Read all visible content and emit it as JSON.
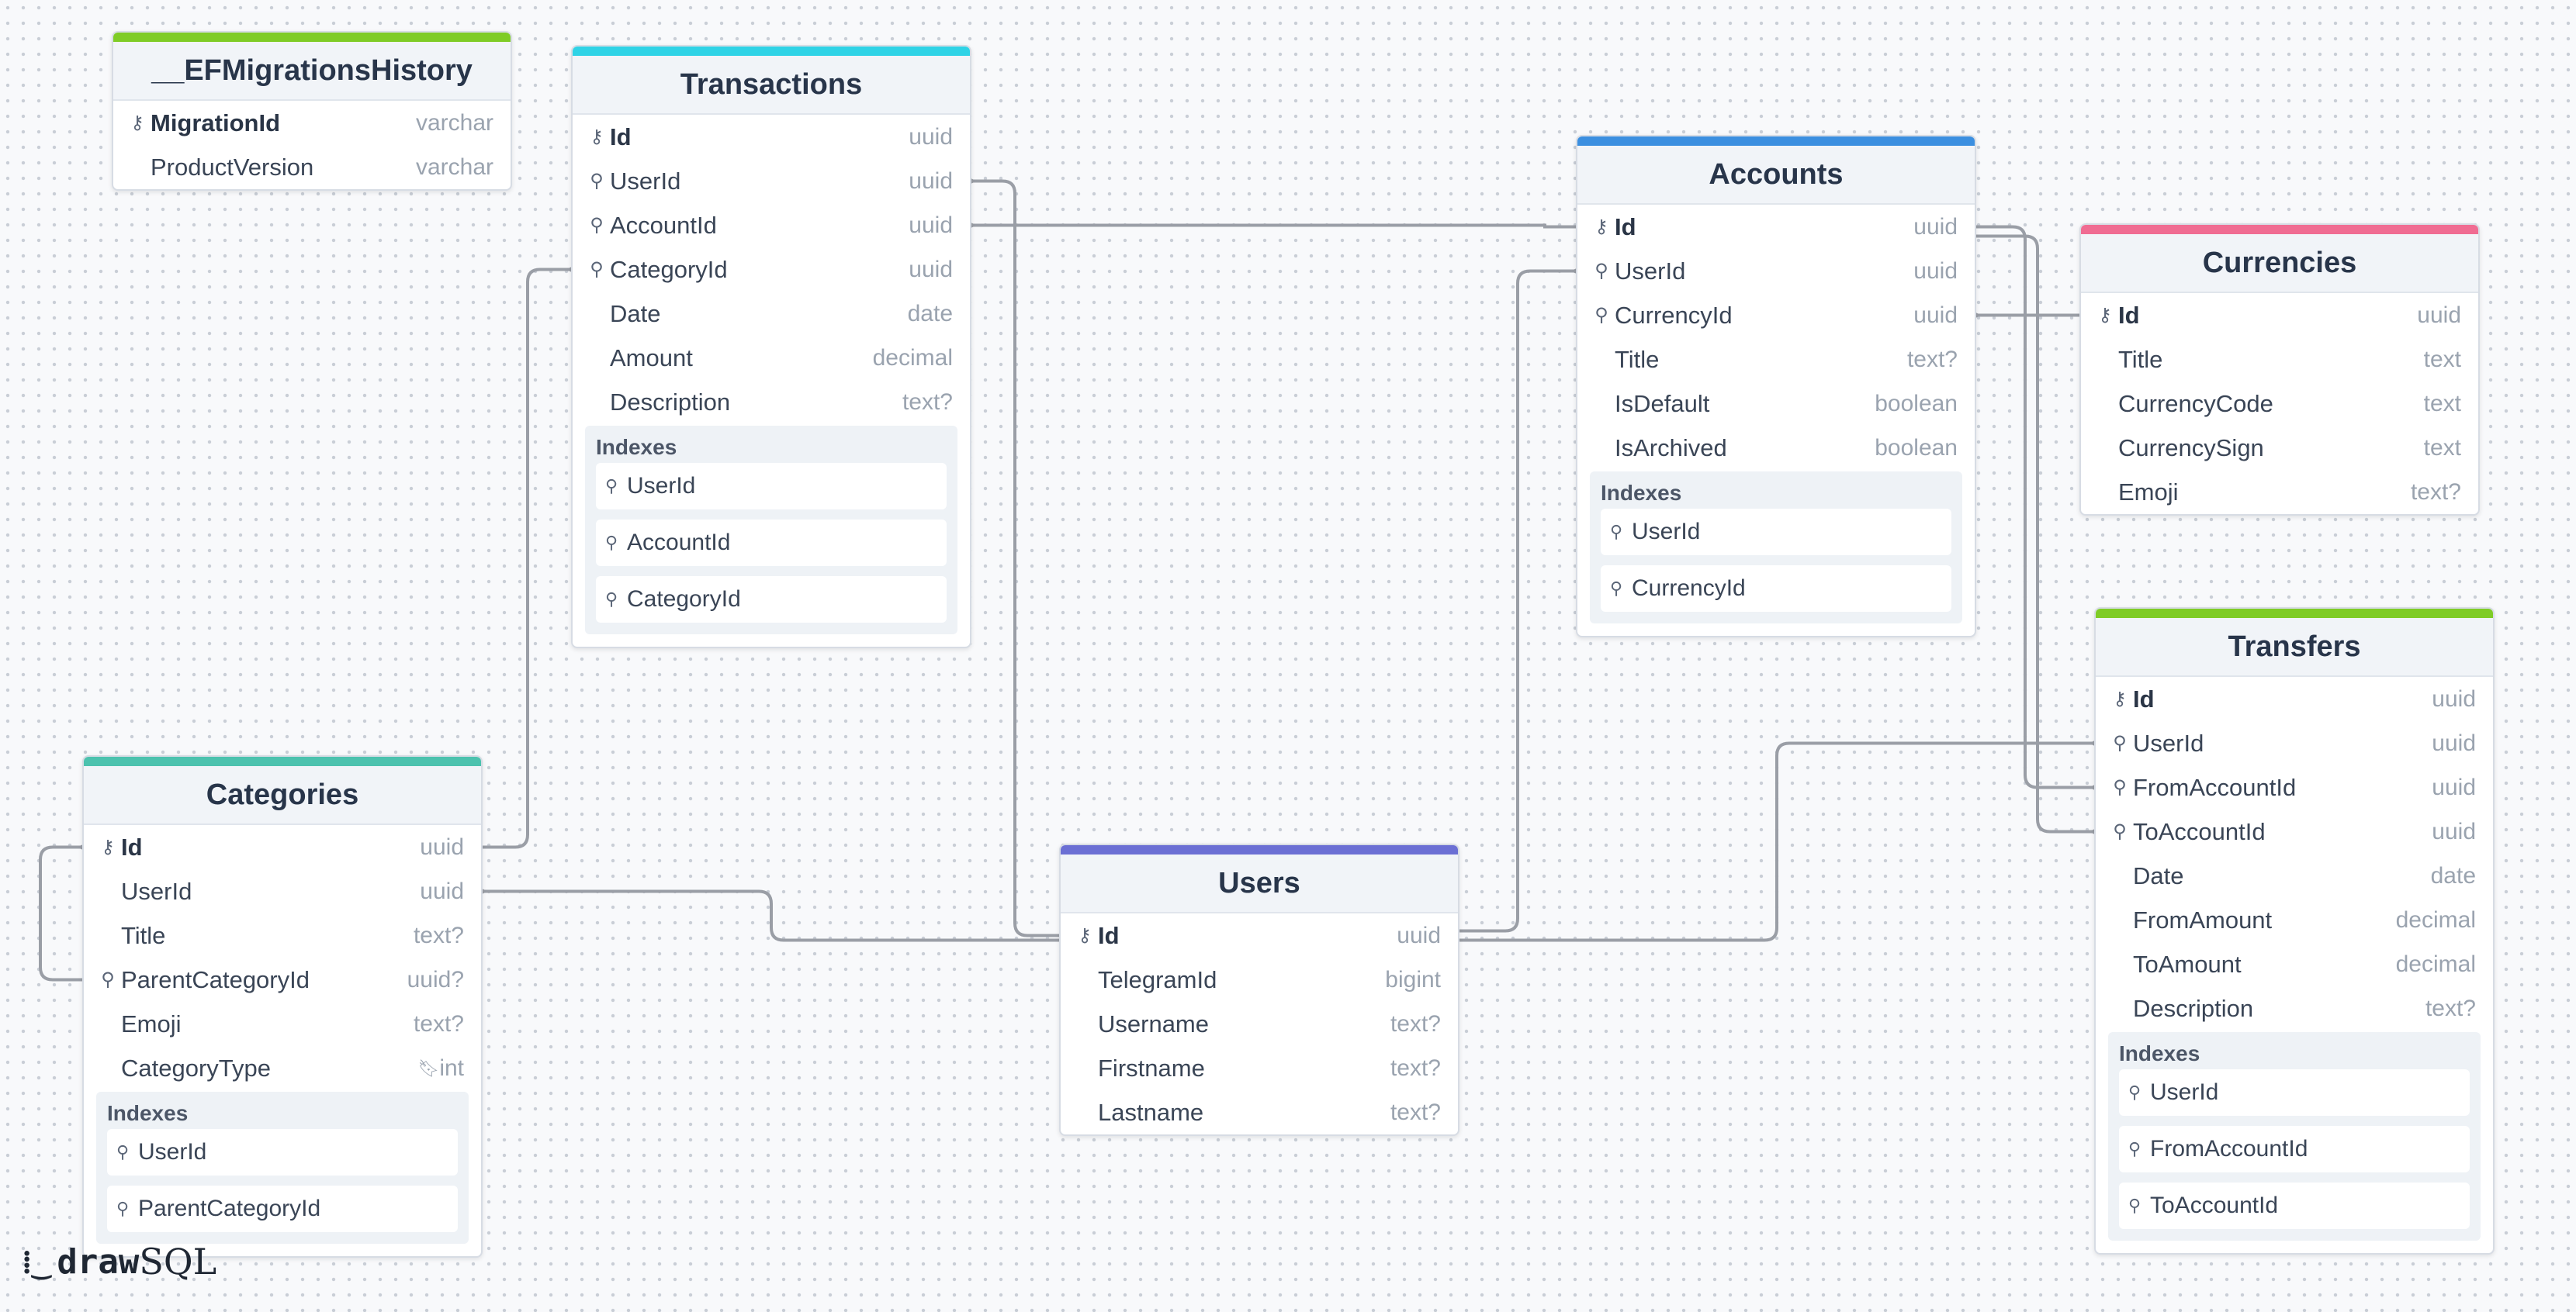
{
  "brand": {
    "word_bold": "draw",
    "word_light": "SQL"
  },
  "index_heading": "Indexes",
  "icons": {
    "primary_key": "key-icon",
    "foreign_key": "fk-pin-icon",
    "enum": "bookmark-icon"
  },
  "tables": [
    {
      "id": "efmigrations",
      "name": "__EFMigrationsHistory",
      "color": "#7fcc26",
      "columns": [
        {
          "name": "MigrationId",
          "type": "varchar",
          "key": "pk"
        },
        {
          "name": "ProductVersion",
          "type": "varchar",
          "key": ""
        }
      ],
      "indexes": []
    },
    {
      "id": "transactions",
      "name": "Transactions",
      "color": "#2fd3e6",
      "columns": [
        {
          "name": "Id",
          "type": "uuid",
          "key": "pk"
        },
        {
          "name": "UserId",
          "type": "uuid",
          "key": "fk"
        },
        {
          "name": "AccountId",
          "type": "uuid",
          "key": "fk"
        },
        {
          "name": "CategoryId",
          "type": "uuid",
          "key": "fk"
        },
        {
          "name": "Date",
          "type": "date",
          "key": ""
        },
        {
          "name": "Amount",
          "type": "decimal",
          "key": ""
        },
        {
          "name": "Description",
          "type": "text?",
          "key": ""
        }
      ],
      "indexes": [
        "UserId",
        "AccountId",
        "CategoryId"
      ]
    },
    {
      "id": "accounts",
      "name": "Accounts",
      "color": "#3b8fe0",
      "columns": [
        {
          "name": "Id",
          "type": "uuid",
          "key": "pk"
        },
        {
          "name": "UserId",
          "type": "uuid",
          "key": "fk"
        },
        {
          "name": "CurrencyId",
          "type": "uuid",
          "key": "fk"
        },
        {
          "name": "Title",
          "type": "text?",
          "key": ""
        },
        {
          "name": "IsDefault",
          "type": "boolean",
          "key": ""
        },
        {
          "name": "IsArchived",
          "type": "boolean",
          "key": ""
        }
      ],
      "indexes": [
        "UserId",
        "CurrencyId"
      ]
    },
    {
      "id": "currencies",
      "name": "Currencies",
      "color": "#f06c92",
      "columns": [
        {
          "name": "Id",
          "type": "uuid",
          "key": "pk"
        },
        {
          "name": "Title",
          "type": "text",
          "key": ""
        },
        {
          "name": "CurrencyCode",
          "type": "text",
          "key": ""
        },
        {
          "name": "CurrencySign",
          "type": "text",
          "key": ""
        },
        {
          "name": "Emoji",
          "type": "text?",
          "key": ""
        }
      ],
      "indexes": []
    },
    {
      "id": "transfers",
      "name": "Transfers",
      "color": "#7fcc26",
      "columns": [
        {
          "name": "Id",
          "type": "uuid",
          "key": "pk"
        },
        {
          "name": "UserId",
          "type": "uuid",
          "key": "fk"
        },
        {
          "name": "FromAccountId",
          "type": "uuid",
          "key": "fk"
        },
        {
          "name": "ToAccountId",
          "type": "uuid",
          "key": "fk"
        },
        {
          "name": "Date",
          "type": "date",
          "key": ""
        },
        {
          "name": "FromAmount",
          "type": "decimal",
          "key": ""
        },
        {
          "name": "ToAmount",
          "type": "decimal",
          "key": ""
        },
        {
          "name": "Description",
          "type": "text?",
          "key": ""
        }
      ],
      "indexes": [
        "UserId",
        "FromAccountId",
        "ToAccountId"
      ]
    },
    {
      "id": "categories",
      "name": "Categories",
      "color": "#4cc2ae",
      "columns": [
        {
          "name": "Id",
          "type": "uuid",
          "key": "pk"
        },
        {
          "name": "UserId",
          "type": "uuid",
          "key": ""
        },
        {
          "name": "Title",
          "type": "text?",
          "key": ""
        },
        {
          "name": "ParentCategoryId",
          "type": "uuid?",
          "key": "fk"
        },
        {
          "name": "Emoji",
          "type": "text?",
          "key": ""
        },
        {
          "name": "CategoryType",
          "type": "int",
          "key": "",
          "enum": true
        }
      ],
      "indexes": [
        "UserId",
        "ParentCategoryId"
      ]
    },
    {
      "id": "users",
      "name": "Users",
      "color": "#6b6fd4",
      "columns": [
        {
          "name": "Id",
          "type": "uuid",
          "key": "pk"
        },
        {
          "name": "TelegramId",
          "type": "bigint",
          "key": ""
        },
        {
          "name": "Username",
          "type": "text?",
          "key": ""
        },
        {
          "name": "Firstname",
          "type": "text?",
          "key": ""
        },
        {
          "name": "Lastname",
          "type": "text?",
          "key": ""
        }
      ],
      "indexes": []
    }
  ],
  "relations": [
    {
      "from": "transactions.UserId",
      "to": "users.Id"
    },
    {
      "from": "transactions.AccountId",
      "to": "accounts.Id"
    },
    {
      "from": "transactions.CategoryId",
      "to": "categories.Id"
    },
    {
      "from": "accounts.UserId",
      "to": "users.Id"
    },
    {
      "from": "accounts.CurrencyId",
      "to": "currencies.Id"
    },
    {
      "from": "transfers.UserId",
      "to": "users.Id"
    },
    {
      "from": "transfers.FromAccountId",
      "to": "accounts.Id"
    },
    {
      "from": "transfers.ToAccountId",
      "to": "accounts.Id"
    },
    {
      "from": "categories.ParentCategoryId",
      "to": "categories.Id"
    },
    {
      "from": "categories.UserId",
      "to": "users.Id"
    }
  ]
}
